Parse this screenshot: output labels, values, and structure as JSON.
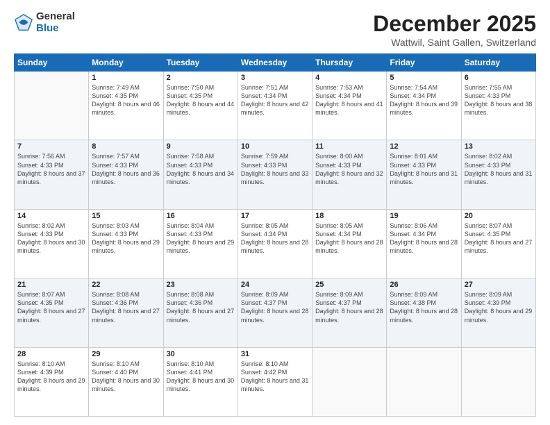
{
  "logo": {
    "general": "General",
    "blue": "Blue"
  },
  "title": "December 2025",
  "subtitle": "Wattwil, Saint Gallen, Switzerland",
  "header_days": [
    "Sunday",
    "Monday",
    "Tuesday",
    "Wednesday",
    "Thursday",
    "Friday",
    "Saturday"
  ],
  "weeks": [
    [
      {
        "day": "",
        "sunrise": "",
        "sunset": "",
        "daylight": ""
      },
      {
        "day": "1",
        "sunrise": "Sunrise: 7:49 AM",
        "sunset": "Sunset: 4:35 PM",
        "daylight": "Daylight: 8 hours and 46 minutes."
      },
      {
        "day": "2",
        "sunrise": "Sunrise: 7:50 AM",
        "sunset": "Sunset: 4:35 PM",
        "daylight": "Daylight: 8 hours and 44 minutes."
      },
      {
        "day": "3",
        "sunrise": "Sunrise: 7:51 AM",
        "sunset": "Sunset: 4:34 PM",
        "daylight": "Daylight: 8 hours and 42 minutes."
      },
      {
        "day": "4",
        "sunrise": "Sunrise: 7:53 AM",
        "sunset": "Sunset: 4:34 PM",
        "daylight": "Daylight: 8 hours and 41 minutes."
      },
      {
        "day": "5",
        "sunrise": "Sunrise: 7:54 AM",
        "sunset": "Sunset: 4:34 PM",
        "daylight": "Daylight: 8 hours and 39 minutes."
      },
      {
        "day": "6",
        "sunrise": "Sunrise: 7:55 AM",
        "sunset": "Sunset: 4:33 PM",
        "daylight": "Daylight: 8 hours and 38 minutes."
      }
    ],
    [
      {
        "day": "7",
        "sunrise": "Sunrise: 7:56 AM",
        "sunset": "Sunset: 4:33 PM",
        "daylight": "Daylight: 8 hours and 37 minutes."
      },
      {
        "day": "8",
        "sunrise": "Sunrise: 7:57 AM",
        "sunset": "Sunset: 4:33 PM",
        "daylight": "Daylight: 8 hours and 36 minutes."
      },
      {
        "day": "9",
        "sunrise": "Sunrise: 7:58 AM",
        "sunset": "Sunset: 4:33 PM",
        "daylight": "Daylight: 8 hours and 34 minutes."
      },
      {
        "day": "10",
        "sunrise": "Sunrise: 7:59 AM",
        "sunset": "Sunset: 4:33 PM",
        "daylight": "Daylight: 8 hours and 33 minutes."
      },
      {
        "day": "11",
        "sunrise": "Sunrise: 8:00 AM",
        "sunset": "Sunset: 4:33 PM",
        "daylight": "Daylight: 8 hours and 32 minutes."
      },
      {
        "day": "12",
        "sunrise": "Sunrise: 8:01 AM",
        "sunset": "Sunset: 4:33 PM",
        "daylight": "Daylight: 8 hours and 31 minutes."
      },
      {
        "day": "13",
        "sunrise": "Sunrise: 8:02 AM",
        "sunset": "Sunset: 4:33 PM",
        "daylight": "Daylight: 8 hours and 31 minutes."
      }
    ],
    [
      {
        "day": "14",
        "sunrise": "Sunrise: 8:02 AM",
        "sunset": "Sunset: 4:33 PM",
        "daylight": "Daylight: 8 hours and 30 minutes."
      },
      {
        "day": "15",
        "sunrise": "Sunrise: 8:03 AM",
        "sunset": "Sunset: 4:33 PM",
        "daylight": "Daylight: 8 hours and 29 minutes."
      },
      {
        "day": "16",
        "sunrise": "Sunrise: 8:04 AM",
        "sunset": "Sunset: 4:33 PM",
        "daylight": "Daylight: 8 hours and 29 minutes."
      },
      {
        "day": "17",
        "sunrise": "Sunrise: 8:05 AM",
        "sunset": "Sunset: 4:34 PM",
        "daylight": "Daylight: 8 hours and 28 minutes."
      },
      {
        "day": "18",
        "sunrise": "Sunrise: 8:05 AM",
        "sunset": "Sunset: 4:34 PM",
        "daylight": "Daylight: 8 hours and 28 minutes."
      },
      {
        "day": "19",
        "sunrise": "Sunrise: 8:06 AM",
        "sunset": "Sunset: 4:34 PM",
        "daylight": "Daylight: 8 hours and 28 minutes."
      },
      {
        "day": "20",
        "sunrise": "Sunrise: 8:07 AM",
        "sunset": "Sunset: 4:35 PM",
        "daylight": "Daylight: 8 hours and 27 minutes."
      }
    ],
    [
      {
        "day": "21",
        "sunrise": "Sunrise: 8:07 AM",
        "sunset": "Sunset: 4:35 PM",
        "daylight": "Daylight: 8 hours and 27 minutes."
      },
      {
        "day": "22",
        "sunrise": "Sunrise: 8:08 AM",
        "sunset": "Sunset: 4:36 PM",
        "daylight": "Daylight: 8 hours and 27 minutes."
      },
      {
        "day": "23",
        "sunrise": "Sunrise: 8:08 AM",
        "sunset": "Sunset: 4:36 PM",
        "daylight": "Daylight: 8 hours and 27 minutes."
      },
      {
        "day": "24",
        "sunrise": "Sunrise: 8:09 AM",
        "sunset": "Sunset: 4:37 PM",
        "daylight": "Daylight: 8 hours and 28 minutes."
      },
      {
        "day": "25",
        "sunrise": "Sunrise: 8:09 AM",
        "sunset": "Sunset: 4:37 PM",
        "daylight": "Daylight: 8 hours and 28 minutes."
      },
      {
        "day": "26",
        "sunrise": "Sunrise: 8:09 AM",
        "sunset": "Sunset: 4:38 PM",
        "daylight": "Daylight: 8 hours and 28 minutes."
      },
      {
        "day": "27",
        "sunrise": "Sunrise: 8:09 AM",
        "sunset": "Sunset: 4:39 PM",
        "daylight": "Daylight: 8 hours and 29 minutes."
      }
    ],
    [
      {
        "day": "28",
        "sunrise": "Sunrise: 8:10 AM",
        "sunset": "Sunset: 4:39 PM",
        "daylight": "Daylight: 8 hours and 29 minutes."
      },
      {
        "day": "29",
        "sunrise": "Sunrise: 8:10 AM",
        "sunset": "Sunset: 4:40 PM",
        "daylight": "Daylight: 8 hours and 30 minutes."
      },
      {
        "day": "30",
        "sunrise": "Sunrise: 8:10 AM",
        "sunset": "Sunset: 4:41 PM",
        "daylight": "Daylight: 8 hours and 30 minutes."
      },
      {
        "day": "31",
        "sunrise": "Sunrise: 8:10 AM",
        "sunset": "Sunset: 4:42 PM",
        "daylight": "Daylight: 8 hours and 31 minutes."
      },
      {
        "day": "",
        "sunrise": "",
        "sunset": "",
        "daylight": ""
      },
      {
        "day": "",
        "sunrise": "",
        "sunset": "",
        "daylight": ""
      },
      {
        "day": "",
        "sunrise": "",
        "sunset": "",
        "daylight": ""
      }
    ]
  ]
}
